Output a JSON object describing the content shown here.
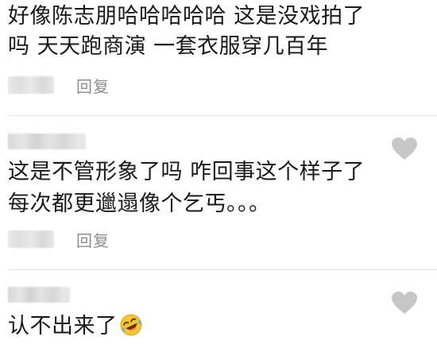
{
  "comments": [
    {
      "lines": [
        "好像陈志朋哈哈哈哈哈 这是没戏拍了",
        "吗 天天跑商演 一套衣服穿几百年"
      ],
      "reply_label": "回复"
    },
    {
      "lines": [
        "这是不管形象了吗 咋回事这个样子了",
        "每次都更邋遢像个乞丐。。。"
      ],
      "reply_label": "回复"
    },
    {
      "lines": [
        "认不出来了"
      ],
      "emoji": "rolling-on-floor-laughing-emoji"
    }
  ],
  "icons": {
    "like": "heart-icon"
  },
  "colors": {
    "text": "#1a1a1a",
    "reply": "#8d8d8d",
    "heart": "#c7c7c7",
    "divider": "#e3e3e3"
  }
}
